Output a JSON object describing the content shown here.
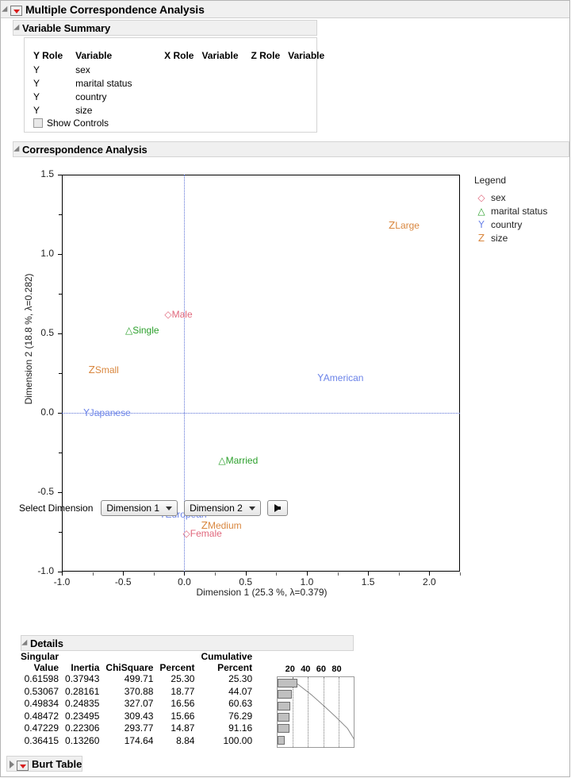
{
  "window": {
    "title": "Multiple Correspondence Analysis"
  },
  "variable_summary": {
    "title": "Variable Summary",
    "headers": [
      "Y Role",
      "Variable",
      "X Role",
      "Variable",
      "Z Role",
      "Variable"
    ],
    "rows": [
      {
        "y_role": "Y",
        "y_var": "sex",
        "x_role": "",
        "x_var": "",
        "z_role": "",
        "z_var": ""
      },
      {
        "y_role": "Y",
        "y_var": "marital status",
        "x_role": "",
        "x_var": "",
        "z_role": "",
        "z_var": ""
      },
      {
        "y_role": "Y",
        "y_var": "country",
        "x_role": "",
        "x_var": "",
        "z_role": "",
        "z_var": ""
      },
      {
        "y_role": "Y",
        "y_var": "size",
        "x_role": "",
        "x_var": "",
        "z_role": "",
        "z_var": ""
      }
    ],
    "show_controls_label": "Show Controls",
    "show_controls_checked": false
  },
  "correspondence_analysis": {
    "title": "Correspondence Analysis",
    "select_dimension": {
      "label": "Select Dimension",
      "dim_x_value": "Dimension 1",
      "dim_y_value": "Dimension 2",
      "go_button_icon": "right-arrow-icon"
    }
  },
  "chart_data": {
    "type": "scatter",
    "title": "Correspondence Analysis",
    "xlabel": "Dimension 1  (25.3 %, λ=0.379)",
    "ylabel": "Dimension 2  (18.8 %, λ=0.282)",
    "xlim": [
      -1.0,
      2.25
    ],
    "ylim": [
      -1.0,
      1.5
    ],
    "xticks": [
      -1.0,
      -0.5,
      0.0,
      0.5,
      1.0,
      1.5,
      2.0
    ],
    "xticklabels": [
      "-1.0",
      "-0.5",
      "0.0",
      "0.5",
      "1.0",
      "1.5",
      "2.0"
    ],
    "yticks": [
      -1.0,
      -0.5,
      0.0,
      0.5,
      1.0,
      1.5
    ],
    "yticklabels": [
      "-1.0",
      "-0.5",
      "0.0",
      "0.5",
      "1.0",
      "1.5"
    ],
    "grid": "reference lines at x=0 and y=0 (blue dotted)",
    "legend_position": "right",
    "legend": {
      "title": "Legend",
      "entries": [
        {
          "symbol": "◇",
          "icon": "diamond-marker-icon",
          "label": "sex",
          "color": "#e0677c"
        },
        {
          "symbol": "△",
          "icon": "triangle-marker-icon",
          "label": "marital status",
          "color": "#2ca02c"
        },
        {
          "symbol": "Y",
          "icon": "y-marker-icon",
          "label": "country",
          "color": "#6b83e8"
        },
        {
          "symbol": "Z",
          "icon": "z-marker-icon",
          "label": "size",
          "color": "#d9873f"
        }
      ]
    },
    "points": [
      {
        "label": "Large",
        "symbol": "Z",
        "group": "size",
        "color": "#d9873f",
        "x": 1.7,
        "y": 1.18
      },
      {
        "label": "Male",
        "symbol": "◇",
        "group": "sex",
        "color": "#e0677c",
        "x": -0.13,
        "y": 0.62
      },
      {
        "label": "Single",
        "symbol": "△",
        "group": "marital status",
        "color": "#2ca02c",
        "x": -0.45,
        "y": 0.52
      },
      {
        "label": "Small",
        "symbol": "Z",
        "group": "size",
        "color": "#d9873f",
        "x": -0.75,
        "y": 0.27
      },
      {
        "label": "American",
        "symbol": "Y",
        "group": "country",
        "color": "#6b83e8",
        "x": 1.12,
        "y": 0.22
      },
      {
        "label": "Japanese",
        "symbol": "Y",
        "group": "country",
        "color": "#6b83e8",
        "x": -0.79,
        "y": 0.0
      },
      {
        "label": "Married",
        "symbol": "△",
        "group": "marital status",
        "color": "#2ca02c",
        "x": 0.31,
        "y": -0.3
      },
      {
        "label": "European",
        "symbol": "Y",
        "group": "country",
        "color": "#6b83e8",
        "x": -0.17,
        "y": -0.64
      },
      {
        "label": "Medium",
        "symbol": "Z",
        "group": "size",
        "color": "#d9873f",
        "x": 0.17,
        "y": -0.71
      },
      {
        "label": "Female",
        "symbol": "◇",
        "group": "sex",
        "color": "#e0677c",
        "x": 0.02,
        "y": -0.76
      }
    ]
  },
  "details": {
    "title": "Details",
    "headers": {
      "singular": "Singular",
      "value": "Value",
      "inertia": "Inertia",
      "chisquare": "ChiSquare",
      "percent": "Percent",
      "cumulative": "Cumulative",
      "cumulative_percent": "Percent"
    },
    "scree_ticks": [
      "20",
      "40",
      "60",
      "80"
    ],
    "rows": [
      {
        "value": "0.61598",
        "inertia": "0.37943",
        "chisquare": "499.71",
        "percent": "25.30",
        "cum_percent": "25.30"
      },
      {
        "value": "0.53067",
        "inertia": "0.28161",
        "chisquare": "370.88",
        "percent": "18.77",
        "cum_percent": "44.07"
      },
      {
        "value": "0.49834",
        "inertia": "0.24835",
        "chisquare": "327.07",
        "percent": "16.56",
        "cum_percent": "60.63"
      },
      {
        "value": "0.48472",
        "inertia": "0.23495",
        "chisquare": "309.43",
        "percent": "15.66",
        "cum_percent": "76.29"
      },
      {
        "value": "0.47229",
        "inertia": "0.22306",
        "chisquare": "293.77",
        "percent": "14.87",
        "cum_percent": "91.16"
      },
      {
        "value": "0.36415",
        "inertia": "0.13260",
        "chisquare": "174.64",
        "percent": "8.84",
        "cum_percent": "100.00"
      }
    ]
  },
  "burt_table": {
    "title": "Burt Table"
  }
}
